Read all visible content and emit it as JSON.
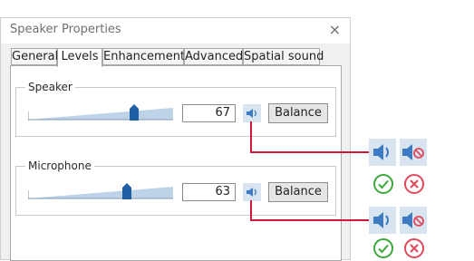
{
  "window": {
    "title": "Speaker Properties",
    "close_glyph": "×"
  },
  "tabs": [
    {
      "label": "General"
    },
    {
      "label": "Levels"
    },
    {
      "label": "Enhancements"
    },
    {
      "label": "Advanced"
    },
    {
      "label": "Spatial sound"
    }
  ],
  "active_tab": "Levels",
  "levels": {
    "speaker": {
      "label": "Speaker",
      "value": "67",
      "level": 0.67,
      "balance_label": "Balance",
      "icon": "speaker-icon"
    },
    "microphone": {
      "label": "Microphone",
      "value": "63",
      "level": 0.63,
      "balance_label": "Balance",
      "icon": "speaker-icon"
    }
  },
  "callout_icons": [
    "speaker-unmuted-icon",
    "speaker-muted-icon",
    "check-circle-icon",
    "cancel-circle-icon"
  ],
  "colors": {
    "accent": "#3d7ac2",
    "callout_line": "#d0183f",
    "check": "#3ca83a",
    "cancel": "#e0495b",
    "tile": "#d8e5f1",
    "slider_track": "#bcd3e8"
  }
}
